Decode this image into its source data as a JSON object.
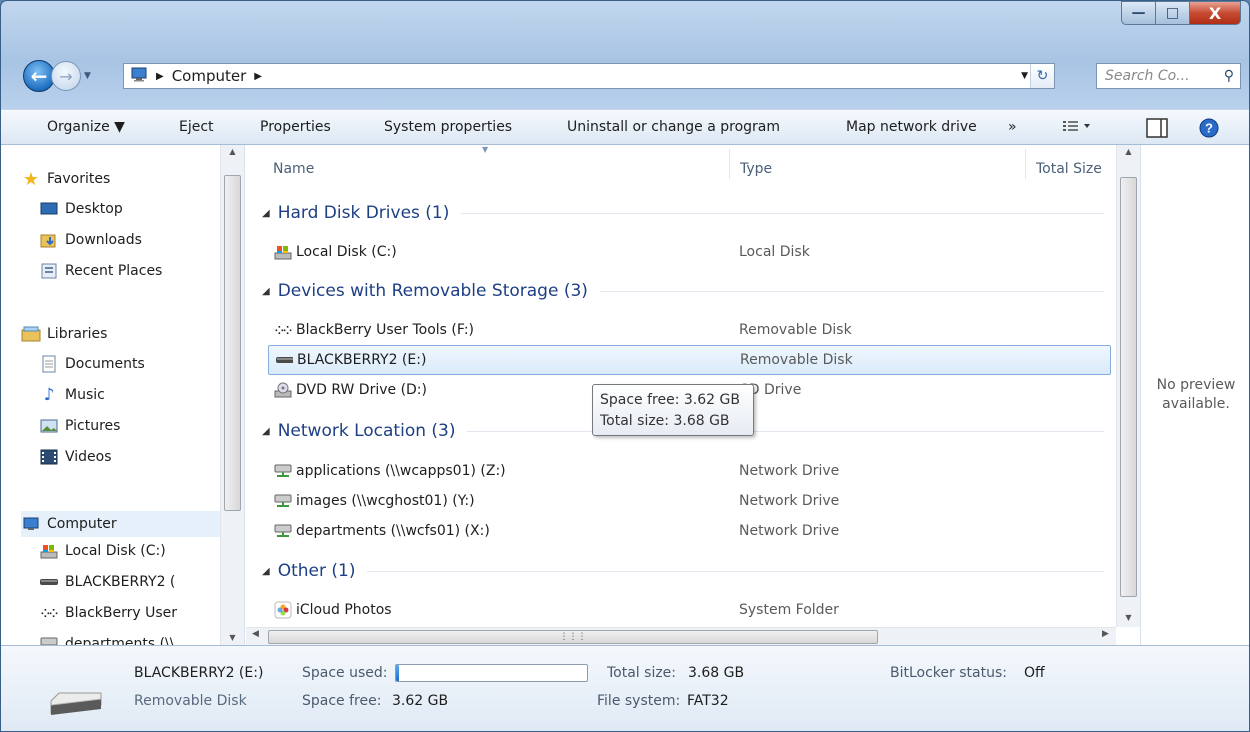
{
  "window": {
    "controls": {
      "minimize": "—",
      "maximize": "□",
      "close": "X"
    }
  },
  "address": {
    "root_icon": "computer-icon",
    "breadcrumb": "Computer",
    "search_placeholder": "Search Co..."
  },
  "toolbar": {
    "organize": "Organize ▼",
    "eject": "Eject",
    "properties": "Properties",
    "system_properties": "System properties",
    "uninstall": "Uninstall or change a program",
    "map_drive": "Map network drive",
    "more": "»"
  },
  "nav_pane": {
    "favorites": "Favorites",
    "desktop": "Desktop",
    "downloads": "Downloads",
    "recent": "Recent Places",
    "libraries": "Libraries",
    "documents": "Documents",
    "music": "Music",
    "pictures": "Pictures",
    "videos": "Videos",
    "computer": "Computer",
    "local_disk": "Local Disk (C:)",
    "blackberry2": "BLACKBERRY2 (",
    "bb_user": "BlackBerry User",
    "departments": "departments (\\\\"
  },
  "columns": {
    "name": "Name",
    "type": "Type",
    "total_size": "Total Size"
  },
  "groups": {
    "hdd": "Hard Disk Drives (1)",
    "removable": "Devices with Removable Storage (3)",
    "network": "Network Location (3)",
    "other": "Other (1)"
  },
  "items": {
    "local_c": {
      "name": "Local Disk (C:)",
      "type": "Local Disk"
    },
    "bb_tools": {
      "name": "BlackBerry User Tools (F:)",
      "type": "Removable Disk"
    },
    "bb2": {
      "name": "BLACKBERRY2 (E:)",
      "type": "Removable Disk"
    },
    "dvd": {
      "name": "DVD RW Drive (D:)",
      "type": "CD Drive"
    },
    "apps": {
      "name": "applications (\\\\wcapps01) (Z:)",
      "type": "Network Drive"
    },
    "images": {
      "name": "images (\\\\wcghost01) (Y:)",
      "type": "Network Drive"
    },
    "depts": {
      "name": "departments (\\\\wcfs01) (X:)",
      "type": "Network Drive"
    },
    "icloud": {
      "name": "iCloud Photos",
      "type": "System Folder"
    }
  },
  "tooltip": {
    "free": "Space free: 3.62 GB",
    "total": "Total size: 3.68 GB"
  },
  "preview": {
    "line1": "No preview",
    "line2": "available."
  },
  "details": {
    "name": "BLACKBERRY2 (E:)",
    "kind": "Removable Disk",
    "space_used_label": "Space used:",
    "space_used_fraction": 0.016,
    "space_free_label": "Space free:",
    "space_free_value": "3.62 GB",
    "total_label": "Total size:",
    "total_value": "3.68 GB",
    "fs_label": "File system:",
    "fs_value": "FAT32",
    "bitlocker_label": "BitLocker status:",
    "bitlocker_value": "Off"
  },
  "colors": {
    "accent": "#1e3f84",
    "selection": "#d9ebfb"
  }
}
